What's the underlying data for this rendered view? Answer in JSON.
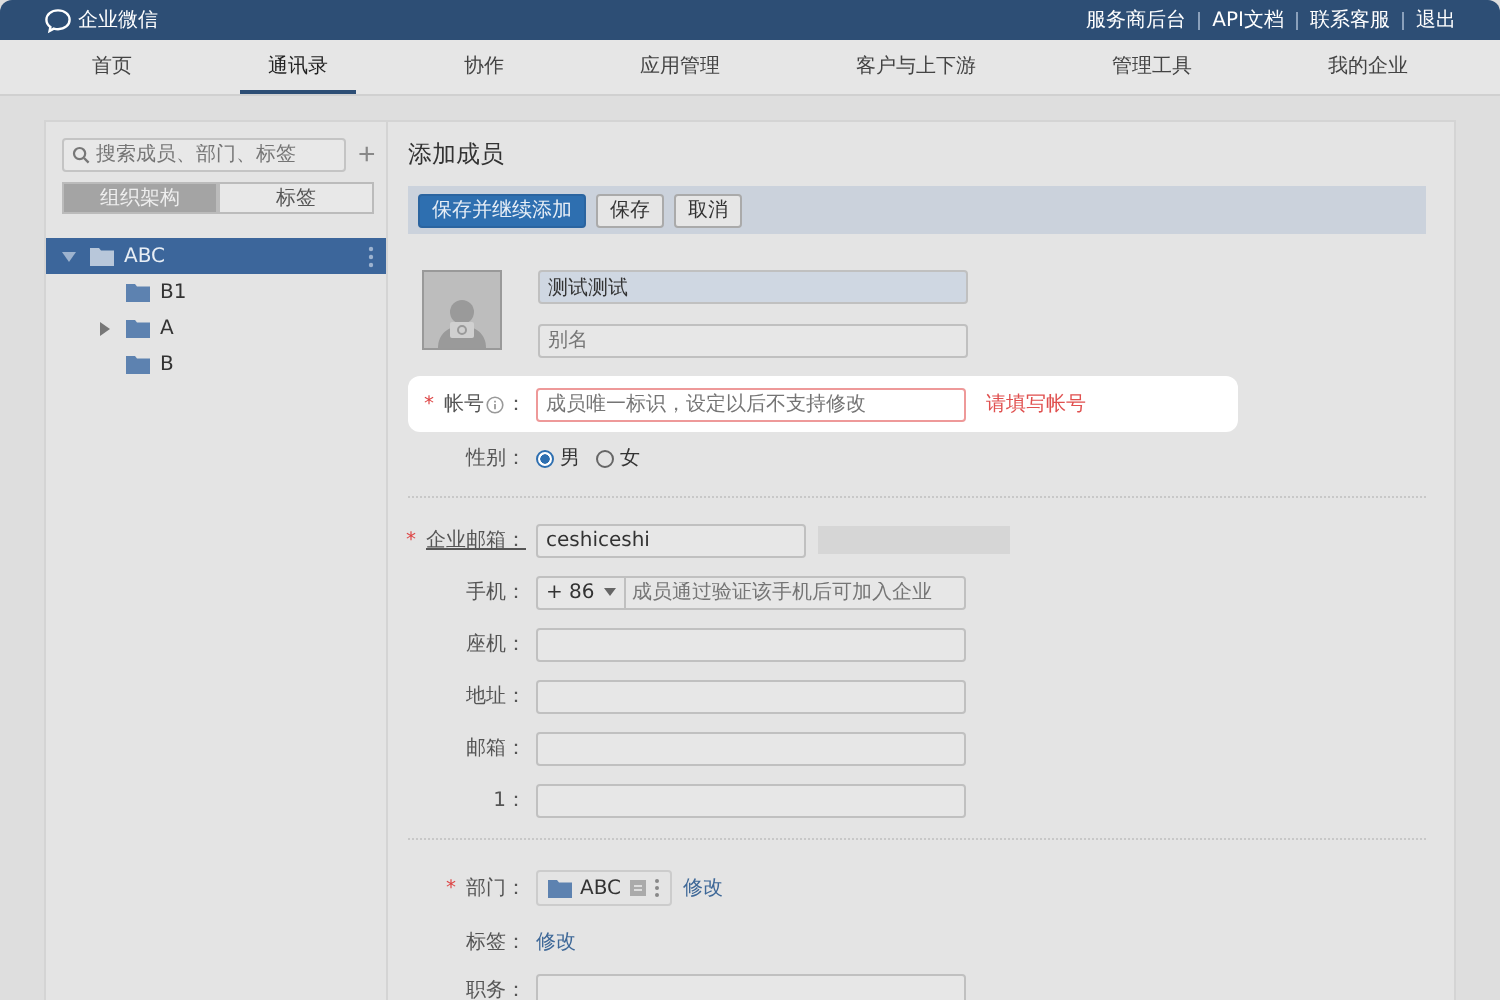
{
  "header": {
    "logo": "企业微信",
    "links": [
      "服务商后台",
      "API文档",
      "联系客服",
      "退出"
    ]
  },
  "nav": [
    {
      "label": "首页",
      "selected": false
    },
    {
      "label": "通讯录",
      "selected": true
    },
    {
      "label": "协作",
      "selected": false
    },
    {
      "label": "应用管理",
      "selected": false
    },
    {
      "label": "客户与上下游",
      "selected": false
    },
    {
      "label": "管理工具",
      "selected": false
    },
    {
      "label": "我的企业",
      "selected": false
    }
  ],
  "sidebar": {
    "search_placeholder": "搜索成员、部门、标签",
    "add": "+",
    "tabs": [
      {
        "label": "组织架构",
        "selected": true
      },
      {
        "label": "标签",
        "selected": false
      }
    ],
    "tree": [
      {
        "label": "ABC",
        "selected": true,
        "expandable": true,
        "expanded": true,
        "children": [
          {
            "label": "B1",
            "selected": false,
            "expandable": false,
            "expanded": false
          },
          {
            "label": "A",
            "selected": false,
            "expandable": true,
            "expanded": false
          },
          {
            "label": "B",
            "selected": false,
            "expandable": false,
            "expanded": false
          }
        ]
      }
    ]
  },
  "form": {
    "title": "添加成员",
    "buttons": [
      {
        "label": "保存并继续添加",
        "kind": "primary"
      },
      {
        "label": "保存",
        "kind": "default"
      },
      {
        "label": "取消",
        "kind": "default"
      }
    ],
    "name_value": "测试测试",
    "alias_placeholder": "别名",
    "account": {
      "label": "帐号",
      "suffix": "：",
      "required_mark": "*",
      "placeholder": "成员唯一标识，设定以后不支持修改",
      "error": "请填写帐号"
    },
    "gender": {
      "label": "性别：",
      "options": [
        {
          "label": "男",
          "selected": true
        },
        {
          "label": "女",
          "selected": false
        }
      ]
    },
    "email": {
      "label": "企业邮箱：",
      "required_mark": "*",
      "value": "ceshiceshi"
    },
    "phone": {
      "label": "手机：",
      "country_code": "+ 86",
      "placeholder": "成员通过验证该手机后可加入企业"
    },
    "fields": [
      {
        "label": "座机："
      },
      {
        "label": "地址："
      },
      {
        "label": "邮箱："
      },
      {
        "label": "1："
      }
    ],
    "department": {
      "label": "部门：",
      "required_mark": "*",
      "value": "ABC",
      "action": "修改"
    },
    "tags": {
      "label": "标签：",
      "action": "修改"
    },
    "position": {
      "label": "职务："
    }
  }
}
